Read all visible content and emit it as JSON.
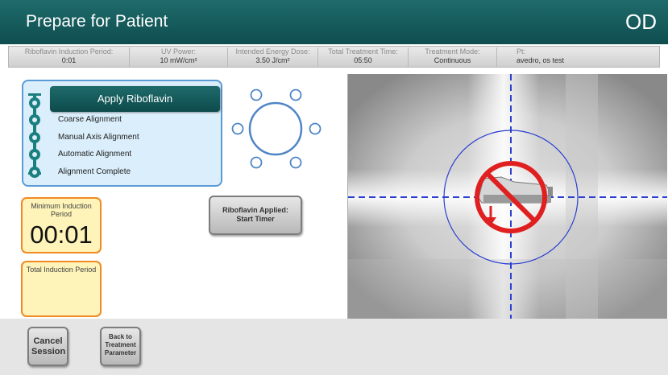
{
  "header": {
    "title": "Prepare for Patient",
    "eye": "OD"
  },
  "params": [
    {
      "label": "Riboflavin Induction Period:",
      "value": "0:01"
    },
    {
      "label": "UV Power:",
      "value": "10 mW/cm²"
    },
    {
      "label": "Intended Energy Dose:",
      "value": "3.50 J/cm²"
    },
    {
      "label": "Total Treatment Time:",
      "value": "05:50"
    },
    {
      "label": "Treatment Mode:",
      "value": "Continuous"
    },
    {
      "label": "Pt:",
      "value": "avedro, os  test"
    }
  ],
  "steps": {
    "active": "Apply Riboflavin",
    "items": [
      "Coarse Alignment",
      "Manual Axis Alignment",
      "Automatic Alignment",
      "Alignment Complete"
    ]
  },
  "timers": {
    "min_label": "Minimum Induction Period",
    "min_value": "00:01",
    "total_label": "Total Induction Period",
    "total_value": ""
  },
  "buttons": {
    "start_timer": "Riboflavin Applied: Start Timer",
    "cancel": "Cancel Session",
    "back": "Back to Treatment Parameter"
  },
  "colors": {
    "header": "#1f6b6b",
    "step_panel": "#dbeefb",
    "step_border": "#5b9bd5",
    "timer_bg": "#fef3b8",
    "timer_border": "#f08a24",
    "prohibit": "#e02020",
    "crosshair": "#2a3fcf"
  },
  "icons": [
    "prohibition-icon",
    "down-arrow-icon",
    "alignment-ring-icon"
  ]
}
